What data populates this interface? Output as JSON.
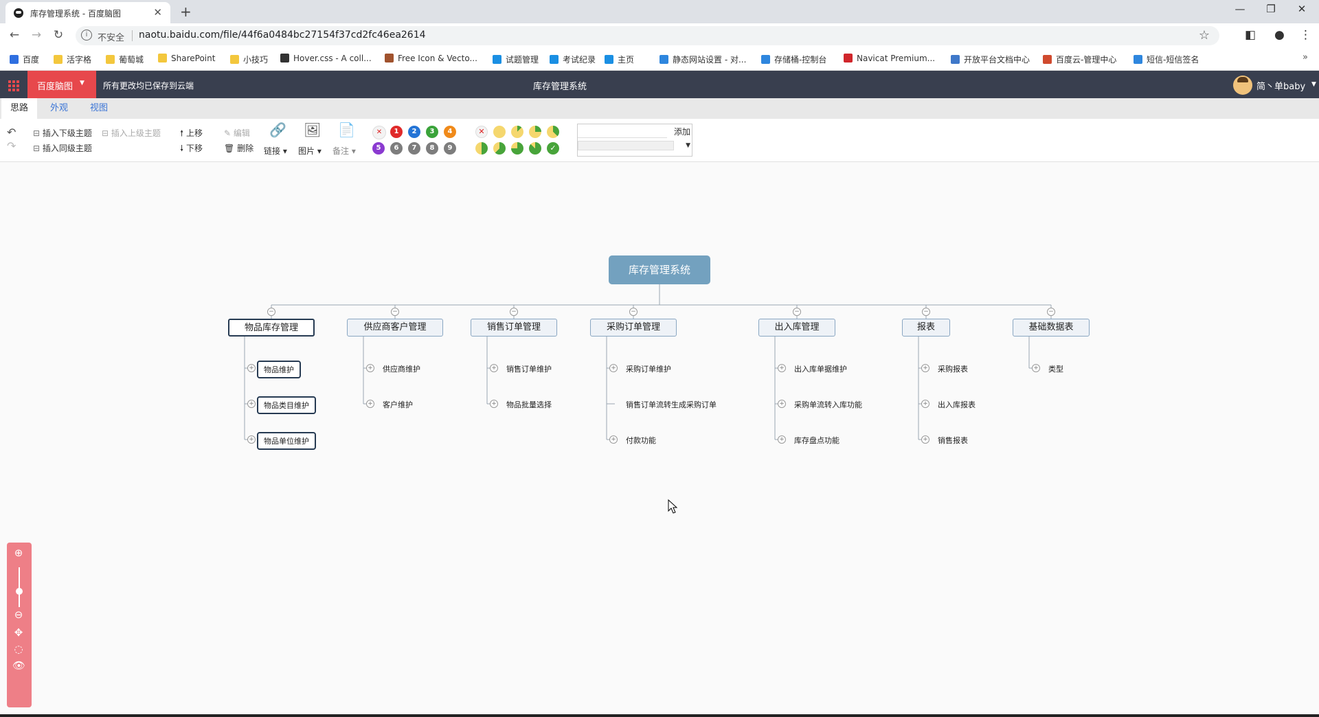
{
  "browser": {
    "tab_title": "库存管理系统 - 百度脑图",
    "insecure_label": "不安全",
    "url": "naotu.baidu.com/file/44f6a0484bc27154f37cd2fc46ea2614"
  },
  "bookmarks": [
    {
      "label": "百度",
      "color": "#2f6fe0"
    },
    {
      "label": "活字格",
      "color": "#f3c73d"
    },
    {
      "label": "葡萄城",
      "color": "#f3c73d"
    },
    {
      "label": "SharePoint",
      "color": "#f3c73d"
    },
    {
      "label": "小技巧",
      "color": "#f3c73d"
    },
    {
      "label": "Hover.css - A coll...",
      "color": "#333333"
    },
    {
      "label": "Free Icon & Vecto...",
      "color": "#a0522d"
    },
    {
      "label": "试题管理",
      "color": "#1a8fe3"
    },
    {
      "label": "考试纪录",
      "color": "#1a8fe3"
    },
    {
      "label": "主页",
      "color": "#1a8fe3"
    },
    {
      "label": "静态网站设置 - 对...",
      "color": "#2e86de"
    },
    {
      "label": "存储桶-控制台",
      "color": "#2e86de"
    },
    {
      "label": "Navicat Premium...",
      "color": "#d0262b"
    },
    {
      "label": "开放平台文档中心",
      "color": "#3f78c9"
    },
    {
      "label": "百度云-管理中心",
      "color": "#d04a2e"
    },
    {
      "label": "短信-短信签名",
      "color": "#2e86de"
    }
  ],
  "app": {
    "brand": "百度脑图",
    "saved_status": "所有更改均已保存到云端",
    "doc_title": "库存管理系统",
    "user_name": "简丶单baby"
  },
  "main_tabs": [
    "思路",
    "外观",
    "视图"
  ],
  "ribbon": {
    "insert_child": "插入下级主题",
    "insert_parent": "插入上级主题",
    "insert_sibling": "插入同级主题",
    "move_up": "上移",
    "move_down": "下移",
    "edit": "编辑",
    "delete": "删除",
    "link": "链接",
    "image": "图片",
    "note": "备注",
    "priorities": [
      "1",
      "2",
      "3",
      "4",
      "5",
      "6",
      "7",
      "8",
      "9"
    ],
    "priority_colors": [
      "#e02a2a",
      "#2474d6",
      "#3aa33a",
      "#f08a1a",
      "#8a3ad0",
      "#7d7d7d",
      "#7d7d7d",
      "#7d7d7d",
      "#7d7d7d"
    ],
    "resource_add": "添加"
  },
  "mindmap": {
    "root": "库存管理系统",
    "branches": [
      {
        "label": "物品库存管理",
        "children": [
          "物品维护",
          "物品类目维护",
          "物品单位维护"
        ]
      },
      {
        "label": "供应商客户管理",
        "children": [
          "供应商维护",
          "客户维护"
        ]
      },
      {
        "label": "销售订单管理",
        "children": [
          "销售订单维护",
          "物品批量选择"
        ]
      },
      {
        "label": "采购订单管理",
        "children": [
          "采购订单维护",
          "销售订单流转生成采购订单",
          "付款功能"
        ]
      },
      {
        "label": "出入库管理",
        "children": [
          "出入库单据维护",
          "采购单流转入库功能",
          "库存盘点功能"
        ]
      },
      {
        "label": "报表",
        "children": [
          "采购报表",
          "出入库报表",
          "销售报表"
        ]
      },
      {
        "label": "基础数据表",
        "children": [
          "类型"
        ]
      }
    ]
  }
}
